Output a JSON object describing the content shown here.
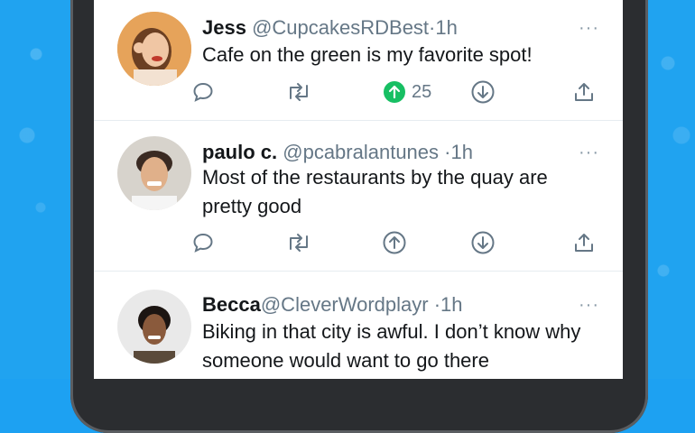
{
  "tweets": [
    {
      "name": "Jess",
      "handle": "@CupcakesRDBest",
      "time": "·1h",
      "text": "Cafe on the green is my favorite spot!",
      "upvotes": "25",
      "upvoted": true
    },
    {
      "name": "paulo c.",
      "handle": "@pcabralantunes",
      "time": "·1h",
      "text": "Most of the restaurants by the quay are pretty good",
      "upvoted": false
    },
    {
      "name": "Becca",
      "handle": "@CleverWordplayr",
      "time": "·1h",
      "text": "Biking in that city is awful. I don’t know why someone would want to go there"
    }
  ],
  "more_glyph": "···",
  "icons": {
    "reply": "reply-icon",
    "retweet": "retweet-icon",
    "upvote": "upvote-icon",
    "downvote": "downvote-icon",
    "share": "share-icon"
  },
  "colors": {
    "upvote_active": "#17bf63",
    "background": "#1da1f2",
    "text_secondary": "#657786"
  }
}
